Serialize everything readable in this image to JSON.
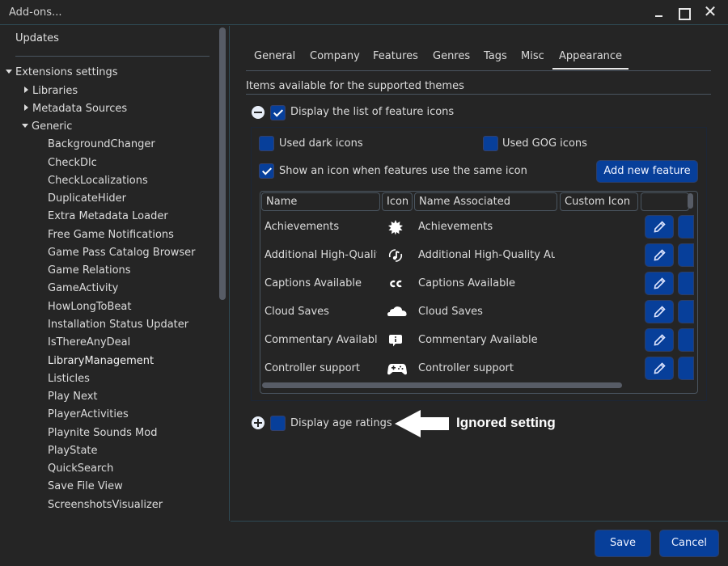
{
  "window": {
    "title": "Add-ons...",
    "controls": [
      "minimize",
      "maximize",
      "close"
    ]
  },
  "sidebar": {
    "updates_label": "Updates",
    "extensions_label": "Extensions settings",
    "groups": [
      {
        "label": "Libraries",
        "expanded": false
      },
      {
        "label": "Metadata Sources",
        "expanded": false
      },
      {
        "label": "Generic",
        "expanded": true
      }
    ],
    "generic_items": [
      "BackgroundChanger",
      "CheckDlc",
      "CheckLocalizations",
      "DuplicateHider",
      "Extra Metadata Loader",
      "Free Game Notifications",
      "Game Pass Catalog Browser",
      "Game Relations",
      "GameActivity",
      "HowLongToBeat",
      "Installation Status Updater",
      "IsThereAnyDeal",
      "LibraryManagement",
      "Listicles",
      "Play Next",
      "PlayerActivities",
      "Playnite Sounds Mod",
      "PlayState",
      "QuickSearch",
      "Save File View",
      "ScreenshotsVisualizer"
    ],
    "selected": "LibraryManagement"
  },
  "tabs": [
    {
      "label": "General"
    },
    {
      "label": "Company"
    },
    {
      "label": "Features"
    },
    {
      "label": "Genres"
    },
    {
      "label": "Tags"
    },
    {
      "label": "Misc"
    },
    {
      "label": "Appearance",
      "active": true
    }
  ],
  "appearance": {
    "section_title": "Items available for the supported themes",
    "display_feature_icons": {
      "label": "Display the list of feature icons",
      "checked": true,
      "expanded": true
    },
    "used_dark_icons": {
      "label": "Used dark icons",
      "checked": false
    },
    "used_gog_icons": {
      "label": "Used GOG icons",
      "checked": false
    },
    "show_same_icon": {
      "label": "Show an icon when features use the same icon",
      "checked": true
    },
    "add_feature_label": "Add new feature",
    "grid": {
      "columns": [
        "Name",
        "Icon",
        "Name Associated",
        "Custom Icon",
        ""
      ],
      "rows": [
        {
          "name": "Achievements",
          "icon": "achievement-badge-icon",
          "associated": "Achievements"
        },
        {
          "name": "Additional High-Quality Audio",
          "icon": "music-note-icon",
          "associated": "Additional High-Quality Audio"
        },
        {
          "name": "Captions Available",
          "icon": "closed-captions-icon",
          "associated": "Captions Available"
        },
        {
          "name": "Cloud Saves",
          "icon": "cloud-icon",
          "associated": "Cloud Saves"
        },
        {
          "name": "Commentary Available",
          "icon": "info-speech-bubble-icon",
          "associated": "Commentary Available"
        },
        {
          "name": "Controller support",
          "icon": "gamepad-icon",
          "associated": "Controller support"
        }
      ]
    },
    "display_age_ratings": {
      "label": "Display age ratings",
      "checked": false,
      "expanded": false
    }
  },
  "annotation": {
    "text": "Ignored setting"
  },
  "footer": {
    "save_label": "Save",
    "cancel_label": "Cancel"
  },
  "colors": {
    "accent": "#073f9a",
    "background": "#252525",
    "border": "#2f4a55"
  }
}
